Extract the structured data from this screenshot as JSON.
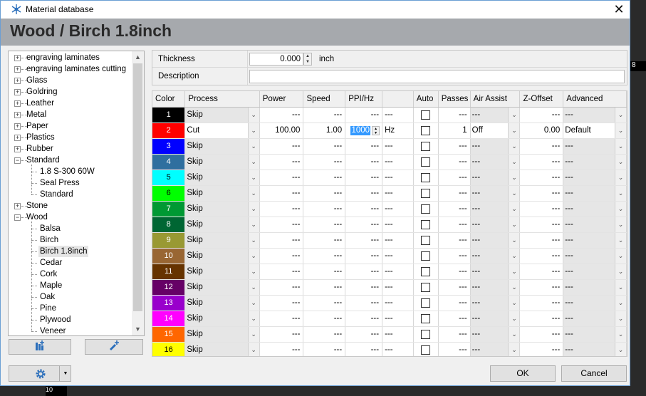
{
  "window": {
    "title": "Material database",
    "close_label": "✕"
  },
  "header": {
    "title": "Wood / Birch 1.8inch"
  },
  "tree": {
    "items": [
      {
        "label": "engraving laminates",
        "level": 0,
        "expander": "+"
      },
      {
        "label": "engraving laminates cutting",
        "level": 0,
        "expander": "+"
      },
      {
        "label": "Glass",
        "level": 0,
        "expander": "+"
      },
      {
        "label": "Goldring",
        "level": 0,
        "expander": "+"
      },
      {
        "label": "Leather",
        "level": 0,
        "expander": "+"
      },
      {
        "label": "Metal",
        "level": 0,
        "expander": "+"
      },
      {
        "label": "Paper",
        "level": 0,
        "expander": "+"
      },
      {
        "label": "Plastics",
        "level": 0,
        "expander": "+"
      },
      {
        "label": "Rubber",
        "level": 0,
        "expander": "+"
      },
      {
        "label": "Standard",
        "level": 0,
        "expander": "−"
      },
      {
        "label": "1.8 S-300 60W",
        "level": 1
      },
      {
        "label": "Seal Press",
        "level": 1
      },
      {
        "label": "Standard",
        "level": 1
      },
      {
        "label": "Stone",
        "level": 0,
        "expander": "+"
      },
      {
        "label": "Wood",
        "level": 0,
        "expander": "−"
      },
      {
        "label": "Balsa",
        "level": 1
      },
      {
        "label": "Birch",
        "level": 1
      },
      {
        "label": "Birch 1.8inch",
        "level": 1,
        "selected": true
      },
      {
        "label": "Cedar",
        "level": 1
      },
      {
        "label": "Cork",
        "level": 1
      },
      {
        "label": "Maple",
        "level": 1
      },
      {
        "label": "Oak",
        "level": 1
      },
      {
        "label": "Pine",
        "level": 1
      },
      {
        "label": "Plywood",
        "level": 1
      },
      {
        "label": "Veneer",
        "level": 1
      }
    ]
  },
  "properties": {
    "thickness_label": "Thickness",
    "thickness_value": "0.000",
    "thickness_unit": "inch",
    "description_label": "Description",
    "description_value": ""
  },
  "grid": {
    "columns": [
      "Color",
      "Process",
      "Power",
      "Speed",
      "PPI/Hz",
      "",
      "Auto",
      "Passes",
      "Air Assist",
      "Z-Offset",
      "Advanced"
    ],
    "rows": [
      {
        "num": "1",
        "color": "#000000",
        "process": "Skip",
        "power": "---",
        "speed": "---",
        "ppi": "---",
        "hz": "---",
        "auto": false,
        "passes": "---",
        "air": "---",
        "z": "---",
        "adv": "---"
      },
      {
        "num": "2",
        "color": "#ff0000",
        "process": "Cut",
        "power": "100.00",
        "speed": "1.00",
        "ppi": "1000",
        "hz": "Hz",
        "auto": false,
        "passes": "1",
        "air": "Off",
        "z": "0.00",
        "adv": "Default"
      },
      {
        "num": "3",
        "color": "#0000ff",
        "process": "Skip",
        "power": "---",
        "speed": "---",
        "ppi": "---",
        "hz": "---",
        "auto": false,
        "passes": "---",
        "air": "---",
        "z": "---",
        "adv": "---"
      },
      {
        "num": "4",
        "color": "#2f6f9f",
        "process": "Skip",
        "power": "---",
        "speed": "---",
        "ppi": "---",
        "hz": "---",
        "auto": false,
        "passes": "---",
        "air": "---",
        "z": "---",
        "adv": "---"
      },
      {
        "num": "5",
        "color": "#00ffff",
        "process": "Skip",
        "power": "---",
        "speed": "---",
        "ppi": "---",
        "hz": "---",
        "auto": false,
        "passes": "---",
        "air": "---",
        "z": "---",
        "adv": "---"
      },
      {
        "num": "6",
        "color": "#00ff00",
        "process": "Skip",
        "power": "---",
        "speed": "---",
        "ppi": "---",
        "hz": "---",
        "auto": false,
        "passes": "---",
        "air": "---",
        "z": "---",
        "adv": "---"
      },
      {
        "num": "7",
        "color": "#009933",
        "process": "Skip",
        "power": "---",
        "speed": "---",
        "ppi": "---",
        "hz": "---",
        "auto": false,
        "passes": "---",
        "air": "---",
        "z": "---",
        "adv": "---"
      },
      {
        "num": "8",
        "color": "#006633",
        "process": "Skip",
        "power": "---",
        "speed": "---",
        "ppi": "---",
        "hz": "---",
        "auto": false,
        "passes": "---",
        "air": "---",
        "z": "---",
        "adv": "---"
      },
      {
        "num": "9",
        "color": "#999933",
        "process": "Skip",
        "power": "---",
        "speed": "---",
        "ppi": "---",
        "hz": "---",
        "auto": false,
        "passes": "---",
        "air": "---",
        "z": "---",
        "adv": "---"
      },
      {
        "num": "10",
        "color": "#996633",
        "process": "Skip",
        "power": "---",
        "speed": "---",
        "ppi": "---",
        "hz": "---",
        "auto": false,
        "passes": "---",
        "air": "---",
        "z": "---",
        "adv": "---"
      },
      {
        "num": "11",
        "color": "#663300",
        "process": "Skip",
        "power": "---",
        "speed": "---",
        "ppi": "---",
        "hz": "---",
        "auto": false,
        "passes": "---",
        "air": "---",
        "z": "---",
        "adv": "---"
      },
      {
        "num": "12",
        "color": "#660066",
        "process": "Skip",
        "power": "---",
        "speed": "---",
        "ppi": "---",
        "hz": "---",
        "auto": false,
        "passes": "---",
        "air": "---",
        "z": "---",
        "adv": "---"
      },
      {
        "num": "13",
        "color": "#9900cc",
        "process": "Skip",
        "power": "---",
        "speed": "---",
        "ppi": "---",
        "hz": "---",
        "auto": false,
        "passes": "---",
        "air": "---",
        "z": "---",
        "adv": "---"
      },
      {
        "num": "14",
        "color": "#ff00ff",
        "process": "Skip",
        "power": "---",
        "speed": "---",
        "ppi": "---",
        "hz": "---",
        "auto": false,
        "passes": "---",
        "air": "---",
        "z": "---",
        "adv": "---"
      },
      {
        "num": "15",
        "color": "#ff6600",
        "process": "Skip",
        "power": "---",
        "speed": "---",
        "ppi": "---",
        "hz": "---",
        "auto": false,
        "passes": "---",
        "air": "---",
        "z": "---",
        "adv": "---"
      },
      {
        "num": "16",
        "color": "#ffff00",
        "process": "Skip",
        "power": "---",
        "speed": "---",
        "ppi": "---",
        "hz": "---",
        "auto": false,
        "passes": "---",
        "air": "---",
        "z": "---",
        "adv": "---"
      }
    ]
  },
  "buttons": {
    "add_library_icon": "add-library-icon",
    "add_material_icon": "add-material-icon",
    "settings_icon": "gear-icon",
    "ok": "OK",
    "cancel": "Cancel"
  },
  "background": {
    "badge": "8",
    "bottom_badge": "10"
  }
}
